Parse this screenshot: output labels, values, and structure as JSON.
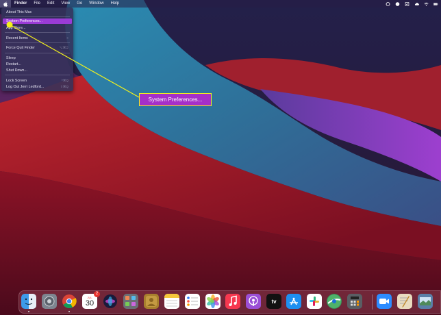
{
  "menubar": {
    "app_name": "Finder",
    "items": [
      "File",
      "Edit",
      "View",
      "Go",
      "Window",
      "Help"
    ]
  },
  "apple_menu": {
    "items": [
      {
        "label": "About This Mac",
        "shortcut": ""
      },
      {
        "label": "System Preferences...",
        "shortcut": ""
      },
      {
        "label": "App Store...",
        "shortcut": ""
      },
      {
        "label": "Recent Items",
        "shortcut": ">"
      },
      {
        "label": "Force Quit Finder",
        "shortcut": "⌥⌘⎋"
      },
      {
        "label": "Sleep",
        "shortcut": ""
      },
      {
        "label": "Restart...",
        "shortcut": ""
      },
      {
        "label": "Shut Down...",
        "shortcut": ""
      },
      {
        "label": "Lock Screen",
        "shortcut": "^⌘Q"
      },
      {
        "label": "Log Out Jerri Ledford...",
        "shortcut": "⇧⌘Q"
      }
    ]
  },
  "callout": {
    "label": "System Preferences...",
    "accent": "#f2f21c",
    "fill": "#a52fc9"
  },
  "dock": {
    "calendar_month": "JUL",
    "calendar_day": "30",
    "calendar_badge": "2",
    "tv_label": "tv",
    "icons": [
      "finder-icon",
      "launchpad-icon",
      "chrome-icon",
      "calendar-icon",
      "siri-icon",
      "slack-apps-icon",
      "contacts-icon",
      "notes-icon",
      "reminders-icon",
      "photos-icon",
      "music-icon",
      "podcasts-icon",
      "apple-tv-icon",
      "app-store-icon",
      "slack-icon",
      "maps-icon",
      "calculator-icon",
      "zoom-icon",
      "textedit-icon",
      "preview-icon"
    ]
  },
  "colors": {
    "wallpaper_teal": "#2d7aa0",
    "wallpaper_red": "#b8202c",
    "wallpaper_purple": "#8a3fc2",
    "highlight": "#9a3bd6"
  }
}
